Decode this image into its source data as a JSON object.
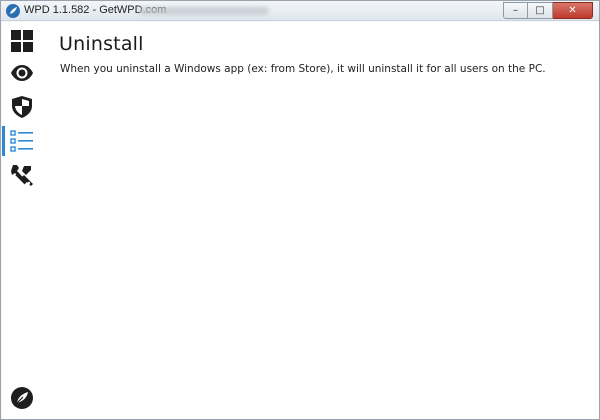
{
  "window": {
    "title": "WPD 1.1.582 - GetWPD.com",
    "controls": {
      "minimize": "–",
      "maximize": "□",
      "close": "✕"
    }
  },
  "sidebar": {
    "items": [
      {
        "icon": "tiles-icon",
        "label": ""
      },
      {
        "icon": "eye-icon",
        "label": ""
      },
      {
        "icon": "shield-icon",
        "label": ""
      },
      {
        "icon": "list-icon",
        "label": "",
        "active": true
      },
      {
        "icon": "tools-icon",
        "label": ""
      }
    ],
    "bottom_icon": "leaf-icon"
  },
  "page": {
    "title": "Uninstall",
    "description": "When you uninstall a Windows app (ex: from Store), it will uninstall it for all users on the PC."
  },
  "colors": {
    "accent": "#2a88d8",
    "icon": "#1e1e1e",
    "titlebar": "#dfe6ee"
  }
}
